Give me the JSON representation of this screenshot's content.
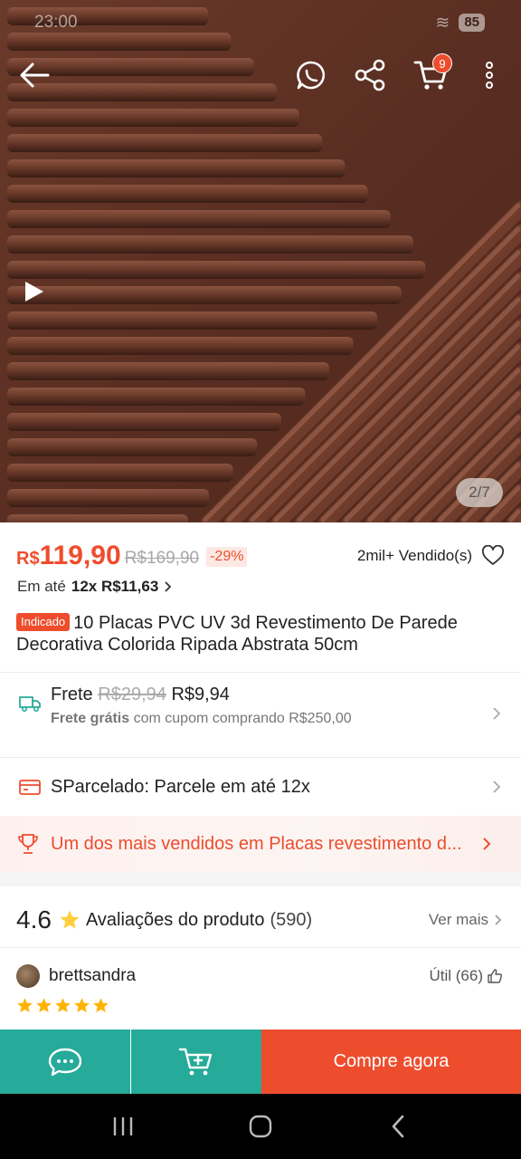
{
  "status_bar": {
    "time": "23:00",
    "battery": "85"
  },
  "top_bar": {
    "cart_count": "9"
  },
  "gallery": {
    "counter": "2/7"
  },
  "price": {
    "currency": "R$",
    "current": "119,90",
    "original": "R$169,90",
    "discount": "-29%",
    "sold": "2mil+ Vendido(s)"
  },
  "installments": {
    "prefix": "Em até",
    "value": "12x R$11,63"
  },
  "product": {
    "tag": "Indicado",
    "title": "10 Placas PVC UV 3d Revestimento De Parede Decorativa Colorida Ripada Abstrata 50cm"
  },
  "shipping": {
    "label": "Frete",
    "old_price": "R$29,94",
    "price": "R$9,94",
    "free_bold": "Frete grátis",
    "free_rest": "com cupom comprando R$250,00"
  },
  "installment_plan": {
    "text": "SParcelado: Parcele em até 12x"
  },
  "best_seller": {
    "text": "Um dos mais vendidos em Placas revestimento d..."
  },
  "reviews": {
    "rating": "4.6",
    "label": "Avaliações do produto",
    "count": "(590)",
    "see_more": "Ver mais",
    "first_review": {
      "user": "brettsandra",
      "helpful": "Útil (66)",
      "stars": 5
    }
  },
  "actions": {
    "buy_now": "Compre agora"
  },
  "colors": {
    "brand": "#ee4d2d",
    "teal": "#26aa99"
  },
  "icons": [
    "back-arrow-icon",
    "whatsapp-icon",
    "share-icon",
    "cart-icon",
    "more-vert-icon",
    "play-icon",
    "heart-icon",
    "chevron-right-icon",
    "truck-icon",
    "card-icon",
    "trophy-icon",
    "star-icon",
    "thumbs-up-icon",
    "chat-icon",
    "add-to-cart-icon",
    "recents-icon",
    "home-icon",
    "nav-back-icon"
  ]
}
